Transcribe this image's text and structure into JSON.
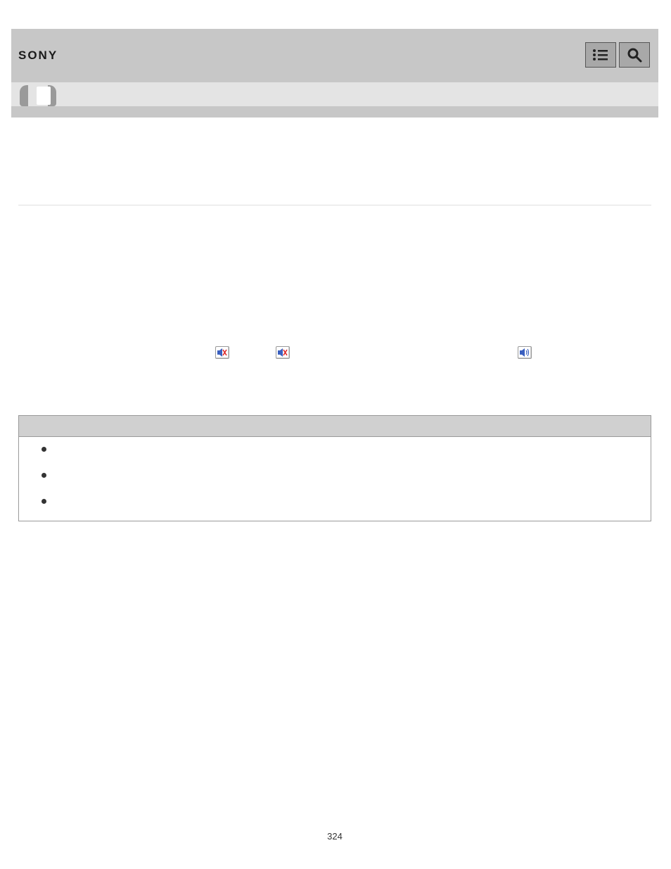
{
  "brand": "SONY",
  "page_number": "324"
}
